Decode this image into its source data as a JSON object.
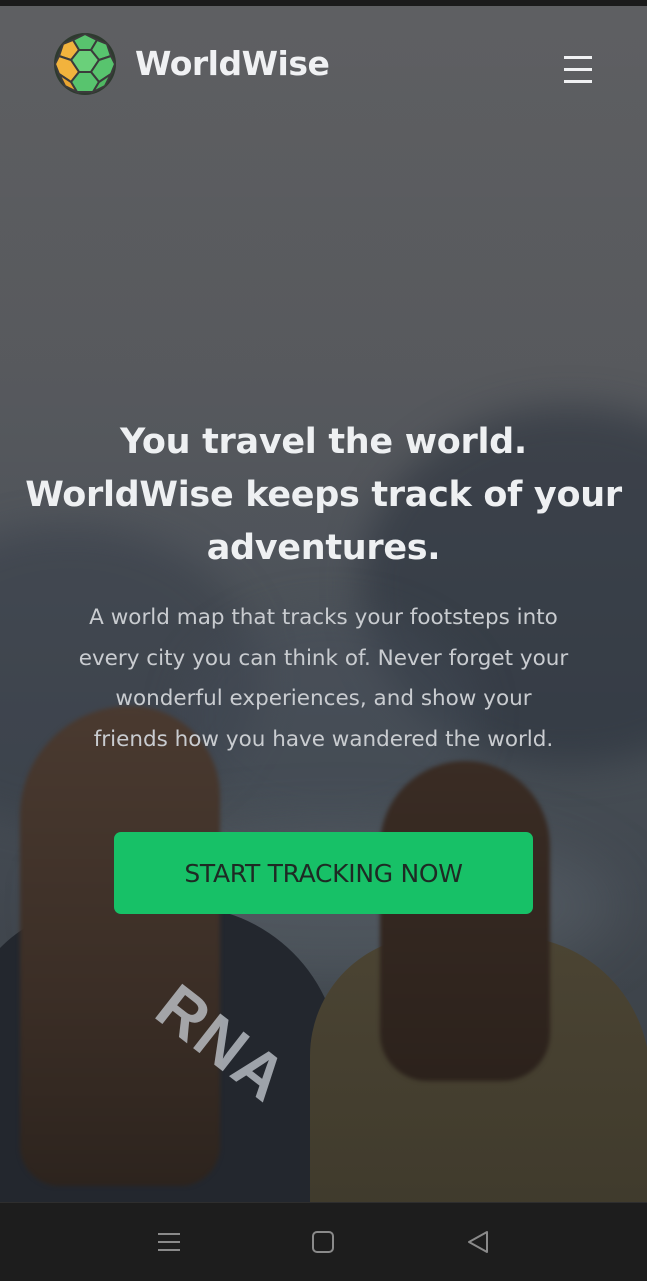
{
  "header": {
    "app_name": "WorldWise",
    "logo_icon": "worldwise-globe-logo",
    "menu_icon": "hamburger-menu-icon"
  },
  "hero": {
    "headline_lines": [
      "You travel the world.",
      "WorldWise keeps track of your",
      "adventures."
    ],
    "description_lines": [
      "A world map that tracks your footsteps into",
      "every city you can think of. Never forget your",
      "wonderful experiences, and show your",
      "friends how you have wandered the world."
    ],
    "cta_label": "START TRACKING NOW",
    "background_photo_text": "RNA"
  },
  "system_nav": {
    "menu_icon": "recent-apps-icon",
    "home_icon": "home-icon",
    "back_icon": "back-icon"
  },
  "colors": {
    "accent": "#17c167",
    "heading_text": "#eef0f2",
    "body_text": "#c9ccd0",
    "nav_bar": "#1d1d1d"
  }
}
